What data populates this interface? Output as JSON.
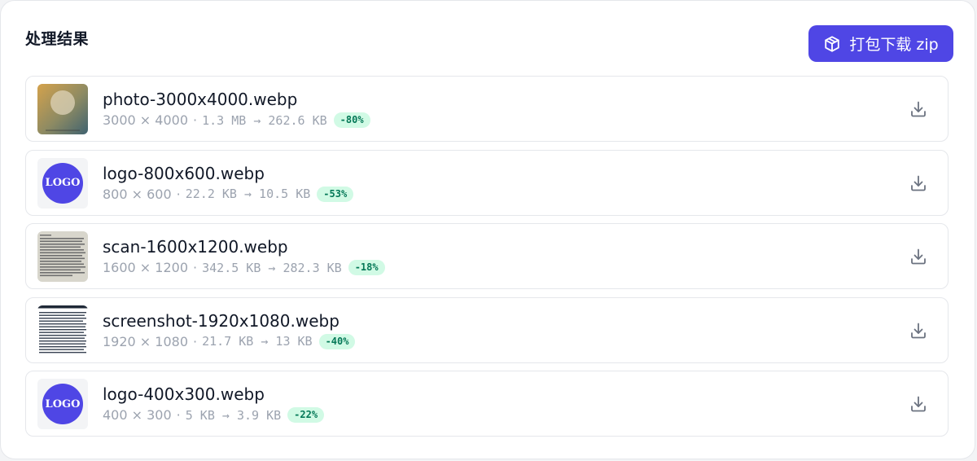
{
  "header": {
    "title": "处理结果",
    "zip_button_label": "打包下载 zip"
  },
  "files": [
    {
      "thumbnail": "photo",
      "name": "photo-3000x4000.webp",
      "dims": "3000 × 4000",
      "sizes": "1.3 MB → 262.6 KB",
      "reduction": "-80%"
    },
    {
      "thumbnail": "logo",
      "logo_text": "LOGO",
      "name": "logo-800x600.webp",
      "dims": "800 × 600",
      "sizes": "22.2 KB → 10.5 KB",
      "reduction": "-53%"
    },
    {
      "thumbnail": "scan",
      "name": "scan-1600x1200.webp",
      "dims": "1600 × 1200",
      "sizes": "342.5 KB → 282.3 KB",
      "reduction": "-18%"
    },
    {
      "thumbnail": "screenshot",
      "name": "screenshot-1920x1080.webp",
      "dims": "1920 × 1080",
      "sizes": "21.7 KB → 13 KB",
      "reduction": "-40%"
    },
    {
      "thumbnail": "logo",
      "logo_text": "LOGO",
      "name": "logo-400x300.webp",
      "dims": "400 × 300",
      "sizes": "5 KB → 3.9 KB",
      "reduction": "-22%"
    }
  ],
  "separator": "·",
  "icons": {
    "zip_button": "package-icon",
    "row_action": "download-icon"
  },
  "colors": {
    "accent": "#4f46e5",
    "badge_bg": "#d1fae5",
    "badge_text": "#047857"
  }
}
